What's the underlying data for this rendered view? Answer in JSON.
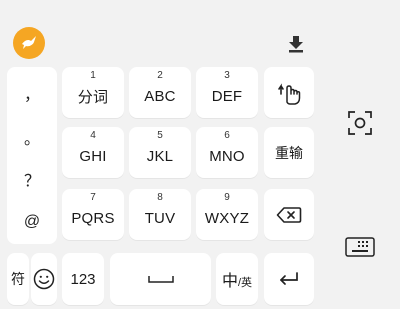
{
  "toolbar": {
    "logo_icon": "hummingbird-logo-icon",
    "collapse_icon": "keyboard-hide-arrow-icon"
  },
  "symbols_column": [
    "，",
    "。",
    "？",
    "@"
  ],
  "keypad": {
    "rows": [
      [
        {
          "num": "1",
          "label": "分词"
        },
        {
          "num": "2",
          "label": "ABC"
        },
        {
          "num": "3",
          "label": "DEF"
        }
      ],
      [
        {
          "num": "4",
          "label": "GHI"
        },
        {
          "num": "5",
          "label": "JKL"
        },
        {
          "num": "6",
          "label": "MNO"
        }
      ],
      [
        {
          "num": "7",
          "label": "PQRS"
        },
        {
          "num": "8",
          "label": "TUV"
        },
        {
          "num": "9",
          "label": "WXYZ"
        }
      ]
    ],
    "retype_label": "重输"
  },
  "bottom_row": {
    "symbol_label": "符",
    "numbers_label": "123",
    "lang_main": "中",
    "lang_sep": "/",
    "lang_alt": "英"
  },
  "icons": {
    "gesture": "hand-gesture-icon",
    "backspace": "backspace-icon",
    "space": "space-bar-icon",
    "enter": "enter-icon",
    "emoji": "emoji-icon",
    "scan": "scan-text-icon",
    "keyboard_switch": "keyboard-switch-icon"
  },
  "colors": {
    "accent": "#f5a623",
    "background": "#f2f2f2",
    "key": "#ffffff"
  }
}
